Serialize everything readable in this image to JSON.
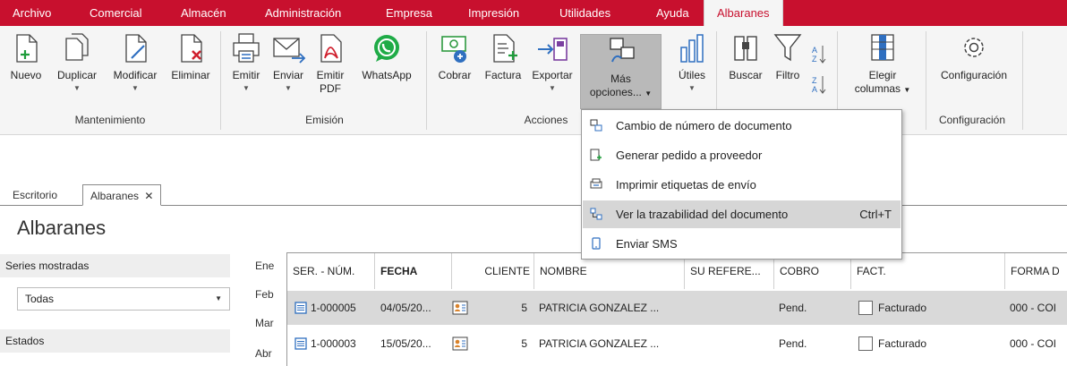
{
  "menubar": {
    "tabs": [
      {
        "label": "Archivo"
      },
      {
        "label": "Comercial"
      },
      {
        "label": "Almacén"
      },
      {
        "label": "Administración"
      },
      {
        "label": "Empresa"
      },
      {
        "label": "Impresión"
      },
      {
        "label": "Utilidades"
      },
      {
        "label": "Ayuda"
      },
      {
        "label": "Albaranes"
      }
    ],
    "active": "Albaranes",
    "color": "#c8102e"
  },
  "ribbon": {
    "mantenimiento": {
      "label": "Mantenimiento",
      "buttons": [
        {
          "label": "Nuevo",
          "icon": "new-document-icon"
        },
        {
          "label": "Duplicar",
          "icon": "duplicate-icon"
        },
        {
          "label": "Modificar",
          "icon": "edit-document-icon"
        },
        {
          "label": "Eliminar",
          "icon": "delete-document-icon"
        }
      ]
    },
    "emision": {
      "label": "Emisión",
      "buttons": [
        {
          "label": "Emitir",
          "icon": "printer-icon"
        },
        {
          "label": "Enviar",
          "icon": "email-icon"
        },
        {
          "label_line1": "Emitir",
          "label_line2": "PDF",
          "icon": "pdf-icon"
        },
        {
          "label": "WhatsApp",
          "icon": "whatsapp-icon"
        }
      ]
    },
    "acciones": {
      "label": "Acciones",
      "buttons": [
        {
          "label": "Cobrar",
          "icon": "money-icon"
        },
        {
          "label": "Factura",
          "icon": "invoice-icon"
        },
        {
          "label": "Exportar",
          "icon": "export-icon"
        },
        {
          "label_line1": "Más",
          "label_line2": "opciones...",
          "icon": "more-options-icon"
        }
      ]
    },
    "utiles": {
      "label": "Útiles",
      "icon": "chart-icon"
    },
    "buscar": {
      "label": "Buscar",
      "icon": "binoculars-icon"
    },
    "filtro": {
      "label": "Filtro",
      "icon": "filter-icon"
    },
    "orden": {
      "icon": "sort-az-icon"
    },
    "columnas": {
      "label_line1": "Elegir",
      "label_line2": "columnas",
      "icon": "columns-icon"
    },
    "configuracion": {
      "label": "Configuración",
      "button_label": "Configuración",
      "icon": "gear-icon"
    }
  },
  "dropdown": {
    "items": [
      {
        "label": "Cambio de número de documento",
        "shortcut": "",
        "icon": "renumber-icon"
      },
      {
        "label": "Generar pedido a proveedor",
        "shortcut": "",
        "icon": "generate-order-icon"
      },
      {
        "label": "Imprimir etiquetas de envío",
        "shortcut": "",
        "icon": "label-printer-icon"
      },
      {
        "label": "Ver la trazabilidad del documento",
        "shortcut": "Ctrl+T",
        "icon": "traceability-icon"
      },
      {
        "label": "Enviar SMS",
        "shortcut": "",
        "icon": "phone-icon"
      }
    ],
    "hovered_index": 3
  },
  "doc_tabs": [
    {
      "label": "Escritorio"
    },
    {
      "label": "Albaranes",
      "close": "✕"
    }
  ],
  "page_title": "Albaranes",
  "sidebar": {
    "series_label": "Series mostradas",
    "series_value": "Todas",
    "estados_label": "Estados"
  },
  "months": [
    "Ene",
    "Feb",
    "Mar",
    "Abr"
  ],
  "table": {
    "headers": [
      "SER. - NÚM.",
      "FECHA",
      "CLIENTE",
      "NOMBRE",
      "SU REFERE...",
      "COBRO",
      "FACT.",
      "FORMA D"
    ],
    "rows": [
      {
        "num": "1-000005",
        "fecha": "04/05/20...",
        "cliente": "5",
        "nombre": "PATRICIA GONZALEZ ...",
        "referencia": "",
        "cobro": "Pend.",
        "fact": "Facturado",
        "forma": "000 - COI",
        "selected": true
      },
      {
        "num": "1-000003",
        "fecha": "15/05/20...",
        "cliente": "5",
        "nombre": "PATRICIA GONZALEZ ...",
        "referencia": "",
        "cobro": "Pend.",
        "fact": "Facturado",
        "forma": "000 - COI",
        "selected": false
      }
    ]
  }
}
